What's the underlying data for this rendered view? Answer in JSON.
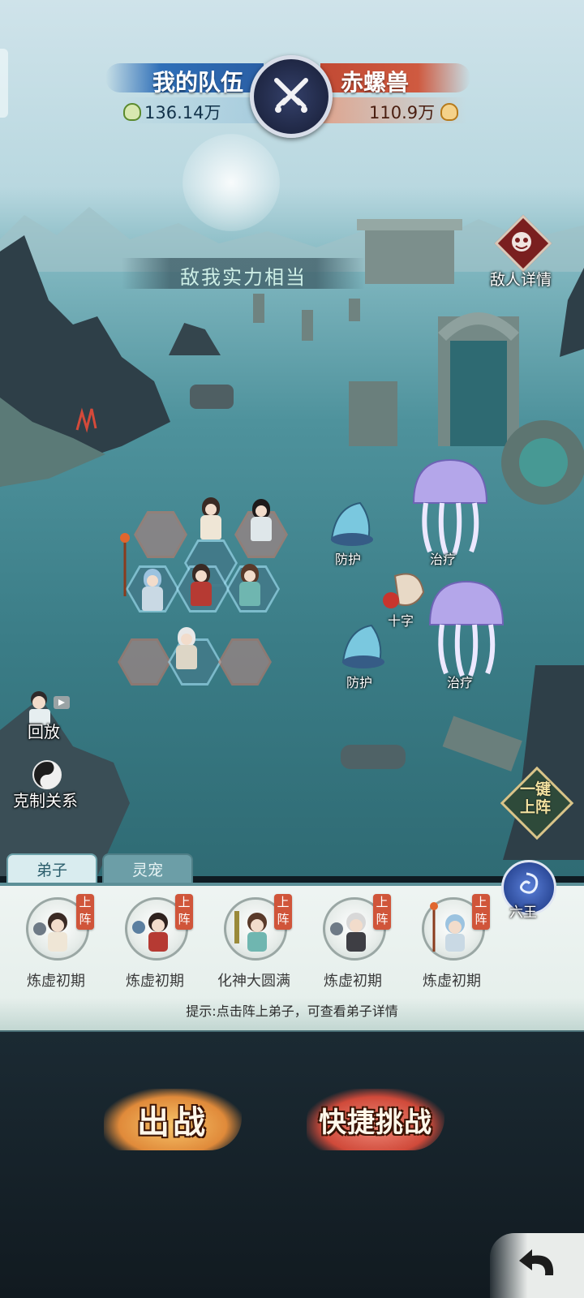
{
  "battle_header": {
    "my_team_name": "我的队伍",
    "my_power": "136.14万",
    "enemy_name": "赤螺兽",
    "enemy_power": "110.9万"
  },
  "strength_banner": "敌我实力相当",
  "enemy_detail_label": "敌人详情",
  "enemy_units": [
    {
      "role": "防护"
    },
    {
      "role": "治疗"
    },
    {
      "role": "十字"
    },
    {
      "role": "防护"
    },
    {
      "role": "治疗"
    }
  ],
  "side_buttons": {
    "replay": "回放",
    "counter_relations": "克制关系",
    "auto_deploy": "一键上阵",
    "six_kings": "六王"
  },
  "roster_tabs": [
    "弟子",
    "灵宠"
  ],
  "deploy_tag": "上阵",
  "roster": [
    {
      "rank": "炼虚初期"
    },
    {
      "rank": "炼虚初期"
    },
    {
      "rank": "化神大圆满"
    },
    {
      "rank": "炼虚初期"
    },
    {
      "rank": "炼虚初期"
    }
  ],
  "hint_text": "提示:点击阵上弟子，可查看弟子详情",
  "actions": {
    "battle": "出战",
    "quick_challenge": "快捷挑战"
  },
  "colors": {
    "my_team": "#2f6fb8",
    "enemy_team": "#cf5a40",
    "sea": "#3a7c86",
    "deploy_tag": "#d0553a"
  }
}
